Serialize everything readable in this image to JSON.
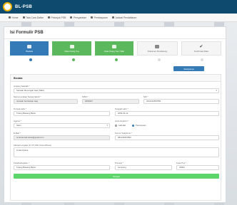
{
  "app": {
    "brand": "BL-PSB"
  },
  "nav": {
    "items": [
      "Home",
      "Tata Cara Daftar",
      "Petunjuk PSB",
      "Persyaratan",
      "Pembayaran",
      "Jadwal Pendaftaran"
    ]
  },
  "page": {
    "title": "Isi Formulir PSB"
  },
  "steps": [
    {
      "label": "Biodata",
      "icon": "user-icon",
      "state": "blue"
    },
    {
      "label": "Data Orang Tua",
      "icon": "group-icon",
      "state": "green"
    },
    {
      "label": "Data Orang Tua / Wali",
      "icon": "users-icon",
      "state": "green"
    },
    {
      "label": "Dokumen Pendukung",
      "icon": "file-icon",
      "state": "gray"
    },
    {
      "label": "Konfirmasi Data",
      "icon": "check-icon",
      "state": "gray"
    }
  ],
  "next_button": "Selanjutnya",
  "form": {
    "header": "Biodata",
    "fields": {
      "program": {
        "label": "Jenjang Sekolah *",
        "value": "Sekolah Menengah Atas (SMA)"
      },
      "nama": {
        "label": "Nama Lengkap Sesuai Ijazah *",
        "value": "Jamaah Sentrawan Haq"
      },
      "nisn": {
        "label": "NISN *",
        "value": "0053637"
      },
      "nik": {
        "label": "NIK *",
        "value": "3201234567890"
      },
      "tempat_lahir": {
        "label": "Tempat Lahir *",
        "value": "Tulang Bawang Barat"
      },
      "tanggal_lahir": {
        "label": "Tanggal Lahir *",
        "value": "2009-04-12"
      },
      "agama": {
        "label": "Agama *",
        "value": "Islam"
      },
      "jenis_kelamin": {
        "label": "Jenis Kelamin *",
        "options": [
          "Laki-laki",
          "Perempuan"
        ],
        "selected": "Perempuan"
      },
      "email": {
        "label": "E-Mail *",
        "value": "contohemail.siswa@gmail.com"
      },
      "telepon": {
        "label": "Nomor Telephone *",
        "value": "081234567890"
      },
      "alamat": {
        "label": "Alamat Lengkap (Jl, RT, RW, Dusun/Desa)",
        "value": "Lintas Kirana"
      },
      "kabupaten": {
        "label": "Kota/Kabupaten *",
        "value": "Tulang Bawang Barat"
      },
      "provinsi": {
        "label": "Provinsi *",
        "value": "Lampung"
      },
      "kode_pos": {
        "label": "Kode Pos *",
        "value": "34691"
      }
    },
    "submit": "Simpan"
  }
}
